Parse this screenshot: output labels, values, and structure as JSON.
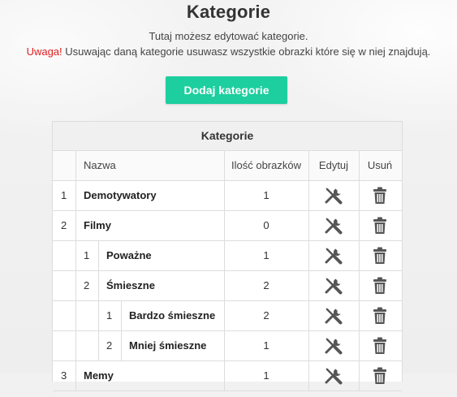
{
  "page": {
    "title": "Kategorie",
    "subtitle": "Tutaj możesz edytować kategorie.",
    "warning_label": "Uwaga!",
    "warning_text": " Usuwając daną kategorie usuwasz wszystkie obrazki które się w niej znajdują."
  },
  "add_button": "Dodaj kategorie",
  "table": {
    "title": "Kategorie",
    "columns": {
      "name": "Nazwa",
      "count": "Ilość obrazków",
      "edit": "Edytuj",
      "delete": "Usuń"
    },
    "rows": [
      {
        "level": 0,
        "num": "1",
        "name": "Demotywatory",
        "count": "1"
      },
      {
        "level": 0,
        "num": "2",
        "name": "Filmy",
        "count": "0"
      },
      {
        "level": 1,
        "num": "1",
        "name": "Poważne",
        "count": "1"
      },
      {
        "level": 1,
        "num": "2",
        "name": "Śmieszne",
        "count": "2"
      },
      {
        "level": 2,
        "num": "1",
        "name": "Bardzo śmieszne",
        "count": "2"
      },
      {
        "level": 2,
        "num": "2",
        "name": "Mniej śmieszne",
        "count": "1"
      },
      {
        "level": 0,
        "num": "3",
        "name": "Memy",
        "count": "1"
      }
    ]
  },
  "icons": {
    "edit": "wrench-screwdriver-icon",
    "delete": "trash-icon"
  },
  "colors": {
    "accent": "#1dcf9e",
    "warning": "#e02020",
    "icon": "#555555"
  }
}
